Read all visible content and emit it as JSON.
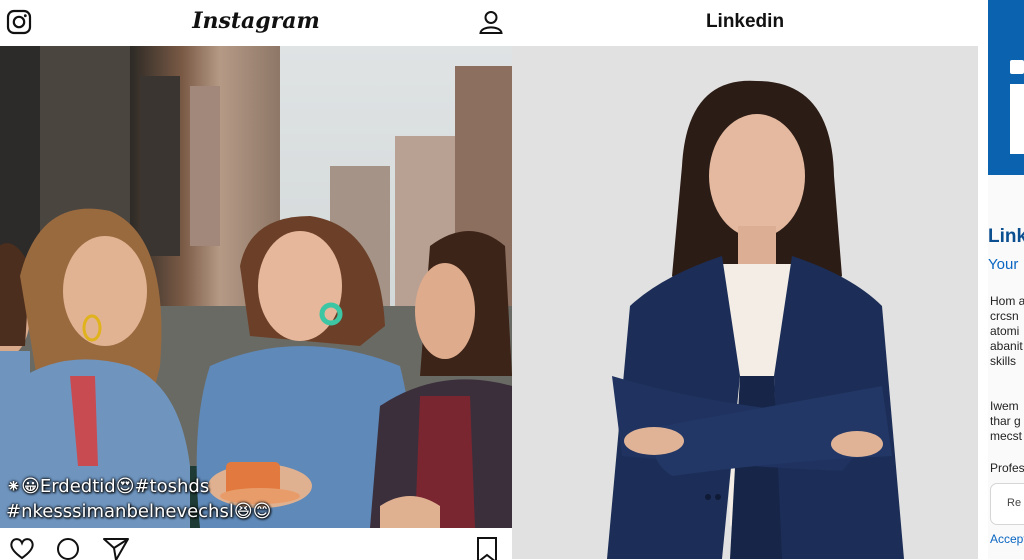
{
  "instagram": {
    "title": "Instagram",
    "caption_line1": "⁕😀Erdedtid😍#toshds",
    "caption_line2": "#nkesssimanbelnevechsl😆😊",
    "colors": {
      "denim": "#6f95bf",
      "teal_earring": "#3cc6a4",
      "mug": "#e27a3f"
    }
  },
  "linkedin": {
    "title": "Linkedin",
    "colors": {
      "blazer": "#1c2e57",
      "backdrop": "#e1e1e1"
    }
  },
  "side": {
    "brand": "Link",
    "subtitle": "Your",
    "para1": "Hom a\ncrcsn\natomi\nabanit\nskills",
    "para2": "Iwem\nthar g\nmecst",
    "label": "Profes",
    "button_label": "Re",
    "link": "Accept",
    "colors": {
      "brand_blue": "#0b63b0"
    }
  }
}
